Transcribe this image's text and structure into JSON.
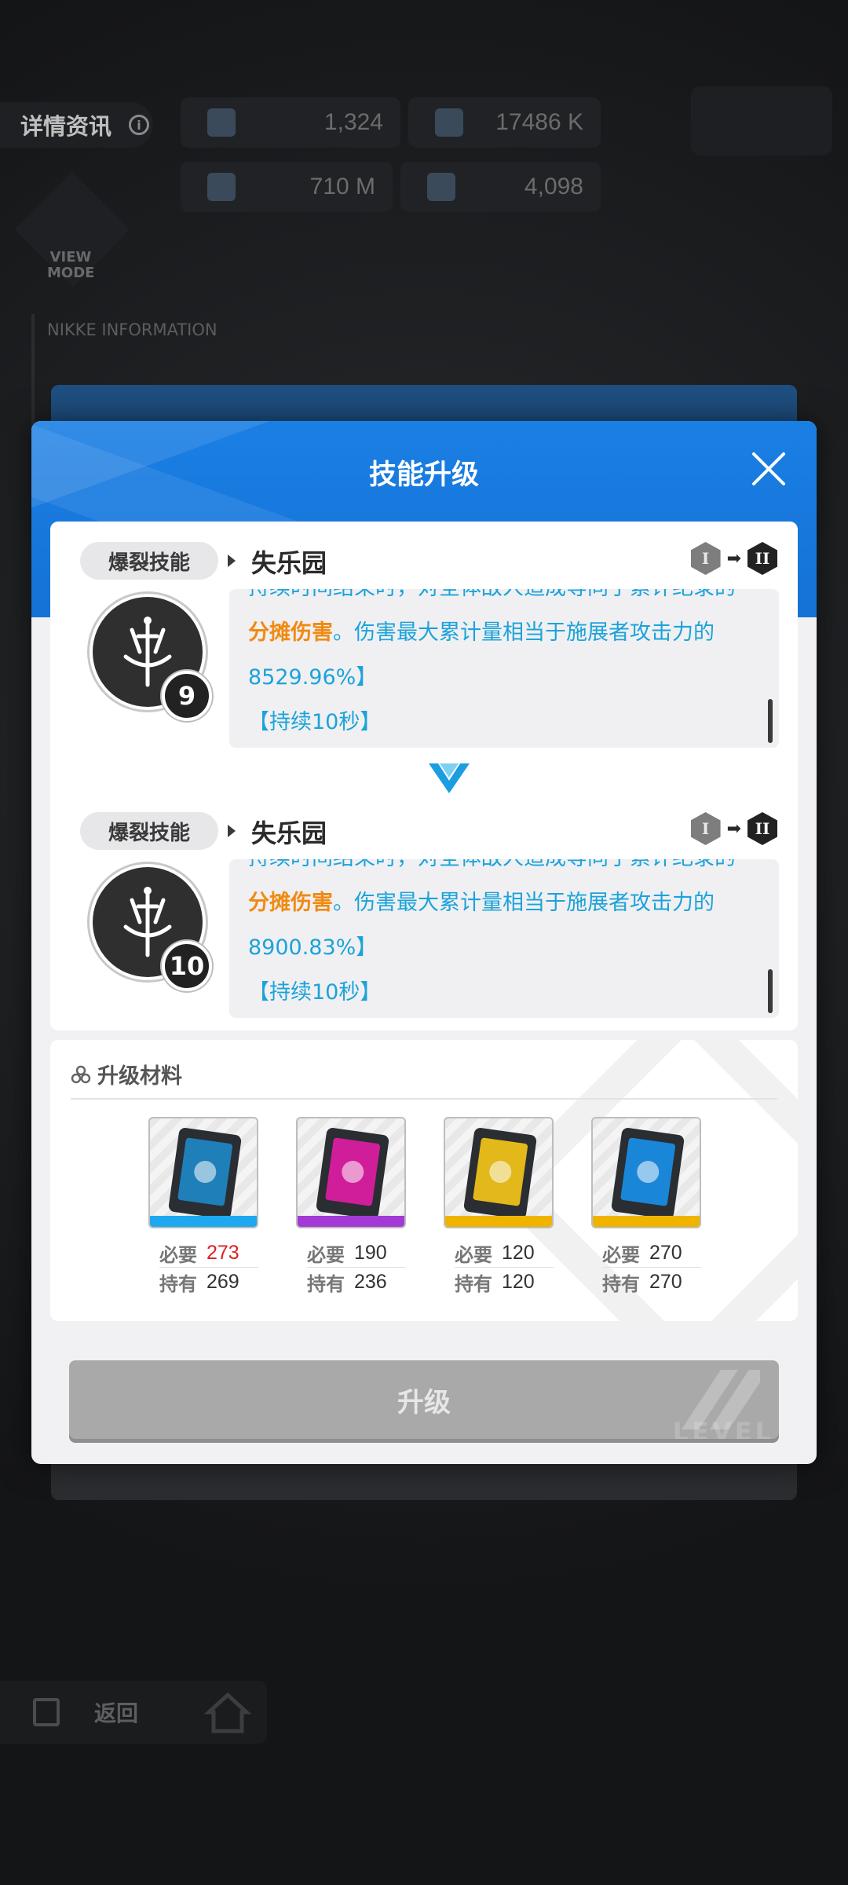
{
  "background": {
    "detail_tab": "详情资讯",
    "view_mode": "VIEW MODE",
    "nikke_info": "NIKKE INFORMATION",
    "stats": [
      "1,324",
      "17486 K",
      "710 M",
      "4,098"
    ],
    "back_label": "返回"
  },
  "modal": {
    "title": "技能升级",
    "close_icon": "close-icon"
  },
  "skills": {
    "current": {
      "tag": "爆裂技能",
      "name": "失乐园",
      "tier_from": "I",
      "tier_to": "II",
      "level": "9",
      "desc_partial": "持续时间结束时，对全体敌人造成等同于累计纪录的",
      "desc_highlight": "分摊伤害",
      "desc_main": "。伤害最大累计量相当于施展者攻击力的8529.96%】",
      "duration": "【持续10秒】"
    },
    "next": {
      "tag": "爆裂技能",
      "name": "失乐园",
      "tier_from": "I",
      "tier_to": "II",
      "level": "10",
      "desc_partial": "持续时间结束时，对全体敌人造成等同于累计纪录的",
      "desc_highlight": "分摊伤害",
      "desc_main": "。伤害最大累计量相当于施展者攻击力的8900.83%】",
      "duration": "【持续10秒】"
    }
  },
  "materials": {
    "title": "升级材料",
    "required_label": "必要",
    "owned_label": "持有",
    "items": [
      {
        "required": "273",
        "owned": "269",
        "color": "#1ea8f0",
        "screen": "#1f7fb8"
      },
      {
        "required": "190",
        "owned": "236",
        "color": "#a23ad6",
        "screen": "#d01e9a"
      },
      {
        "required": "120",
        "owned": "120",
        "color": "#f0b400",
        "screen": "#e2b81a"
      },
      {
        "required": "270",
        "owned": "270",
        "color": "#f0b400",
        "screen": "#1a86d8"
      }
    ]
  },
  "upgrade_button": {
    "label": "升级"
  },
  "colors": {
    "header_blue": "#1572d6",
    "desc_blue": "#1ba3da",
    "highlight_orange": "#f08a12",
    "shortage_red": "#e02020",
    "button_disabled": "#a9a9aa"
  }
}
